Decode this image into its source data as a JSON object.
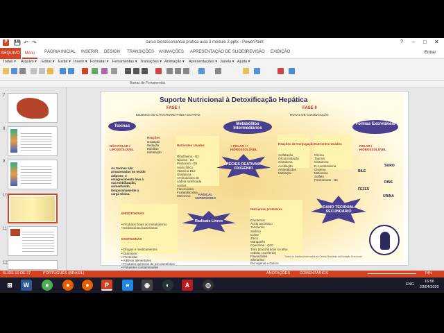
{
  "window": {
    "title": "curso bioressonancia pratica aula 3 módulo 2.pptx - PowerPoint",
    "minimize": "–",
    "maximize": "□",
    "close": "✕",
    "restore": "?"
  },
  "user": {
    "name": "Entrar"
  },
  "ribbon_tabs": [
    "ARQUIVO",
    "Menu",
    "PÁGINA INICIAL",
    "INSERIR",
    "DESIGN",
    "TRANSIÇÕES",
    "ANIMAÇÕES",
    "APRESENTAÇÃO DE SLIDES",
    "REVISÃO",
    "EXIBIÇÃO"
  ],
  "menus": [
    "Todas ▾",
    "Arquivo ▾",
    "Editar ▾",
    "Exibir ▾",
    "Inserir ▾",
    "Formatar ▾",
    "Ferramentas ▾",
    "Transições ▾",
    "Animação ▾",
    "Apresentações ▾",
    "Janela ▾",
    "Ajuda ▾"
  ],
  "toolbar_group": "Barras de Ferramentas",
  "thumbnails": [
    {
      "num": "7"
    },
    {
      "num": "8"
    },
    {
      "num": "9"
    },
    {
      "num": "10"
    },
    {
      "num": "11"
    },
    {
      "num": "12"
    }
  ],
  "slide": {
    "title": "Suporte Nutricional à Detoxificação Hepática",
    "phase1": "FASE I",
    "phase2": "FASE II",
    "enzymes": "ENZIMAS DO CITOCROMO P450 e OUTRAS",
    "rotas": "ROTAS DE CONJUGAÇÃO",
    "toxinas": "Toxinas",
    "metabolitos": "Metabólitos Intermediários",
    "formas": "Formas Excretáveis",
    "nao_polar": "NÃO POLAR / LIPOSSOLÚVEL",
    "mais_polar": "+ POLAR / + HIDROSSOLÚVEL",
    "polar": "POLAR / HIDROSSOLÚVEL",
    "reacoes": "Reações",
    "reacoes_list": "Oxidação\nRedução\nHidrólise\nHidratação",
    "nutrientes1": "Nutrientes Usados",
    "nutrientes1_list": "Riboflavina - B2\nNiacina - B3\nPiridoxina - B6\nÁcido fólico\nVitamina B12\nGlutationa\nAminoácidos de\ncadeia ramificada\nAcidos\nFlavonóides\nFosfatidilcolina\nMetionina",
    "reacoes_conj": "Reações de Conjugação",
    "reacoes_conj_list": "Sulfatação\nGlicuronidação\nGlutationa\nAcetilação\nAminoácidos\nMetilação",
    "nutrientes2": "Nutrientes Usados",
    "nutrientes2_list": "Glicina\nTaurina\nGlutamina\nN-Acetilcisteína\nCisteína\nMetionina\nSulfato\nPantotenato - B5",
    "toxinas_armazenadas": "As toxinas são armazenadas no tecido adiposo; o emagrecimento leva à sua mobilização, aumentando temporariamente a carga tóxica.",
    "especies": "ESPÉCIES REATIVAS DE OXIGÊNIO",
    "radical_superoxido": "RADICAL SUPERÓXIDO",
    "radicais_livres": "Radicais Livres",
    "dano": "DANO TECIDUAL SECUNDÁRIO",
    "bile": "BILE",
    "soro": "SORO",
    "rins": "RINS",
    "fezes": "FEZES",
    "urina": "URINA",
    "endotoxinas": "ENDOTOXINAS",
    "endotoxinas_list": "• Produtos finais do metabolismo\n• Endotoxinas bacterianas",
    "exotoxinas": "EXOTOXINAS",
    "exotoxinas_list": "• Drogas e medicamentos\n• Químicos\n• Pesticidas\n• Aditivos alimentares\n• Produtos químicos de uso doméstico\n• Poluentes contaminantes\n• Microbiano",
    "nutrientes3": "Nutrientes protetores",
    "nutrientes3_list": "Carotenos\nÁcido ascórbico\nTocoferóis\nSelênio\nCobre\nZinco\nManganês\nCoenzima - Q10\nTióis (Encontrados no alho,\ncebola, crucíferas)\nFlavonóides\nSilimarina\nPicnogenol e Outros",
    "credit": "Todos os direitos reservados ao Centro Brasileiro de Nutrição Funcional"
  },
  "status": {
    "slide": "SLIDE 10 DE 37",
    "language": "PORTUGUÊS (BRASIL)",
    "notes": "ANOTAÇÕES",
    "comments": "COMENTÁRIOS",
    "zoom": "74%"
  },
  "taskbar": {
    "lang": "ENG",
    "time": "16:56",
    "date": "23/04/2020"
  },
  "colors": {
    "accent": "#d04423",
    "purple": "#4a3f8f",
    "yellow": "#fff3b0"
  }
}
